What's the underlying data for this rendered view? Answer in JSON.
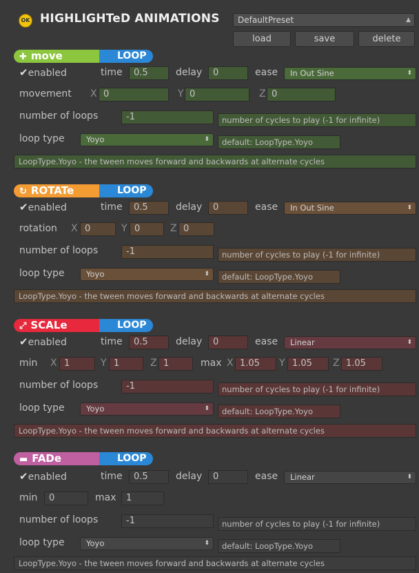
{
  "header": {
    "icon_text": "OK",
    "title": "HIGHLIGHTeD ANIMATIONS",
    "preset": "DefaultPreset",
    "buttons": {
      "load": "load",
      "save": "save",
      "delete": "delete"
    }
  },
  "labels": {
    "enabled": "enabled",
    "time": "time",
    "delay": "delay",
    "ease": "ease",
    "number_of_loops": "number of loops",
    "loop_type": "loop type",
    "cycles_hint": "number of cycles to play (-1 for infinite)",
    "default_hint": "default: LoopType.Yoyo",
    "description": "LoopType.Yoyo - the tween moves forward and backwards at alternate cycles",
    "loop_badge": "LOOP",
    "x": "X",
    "y": "Y",
    "z": "Z",
    "min": "min",
    "max": "max"
  },
  "sections": {
    "move": {
      "name": "move",
      "icon": "✚",
      "color": "#8cc63f",
      "time": "0.5",
      "delay": "0",
      "ease": "In Out Sine",
      "vector_label": "movement",
      "x": "0",
      "y": "0",
      "z": "0",
      "loops": "-1",
      "loop_type": "Yoyo"
    },
    "rotate": {
      "name": "ROTATe",
      "icon": "↻",
      "color": "#f39c34",
      "time": "0.5",
      "delay": "0",
      "ease": "In Out Sine",
      "vector_label": "rotation",
      "x": "0",
      "y": "0",
      "z": "0",
      "loops": "-1",
      "loop_type": "Yoyo"
    },
    "scale": {
      "name": "SCALe",
      "icon": "⤢",
      "color": "#e8283c",
      "time": "0.5",
      "delay": "0",
      "ease": "Linear",
      "min_x": "1",
      "min_y": "1",
      "min_z": "1",
      "max_x": "1.05",
      "max_y": "1.05",
      "max_z": "1.05",
      "loops": "-1",
      "loop_type": "Yoyo"
    },
    "fade": {
      "name": "FADe",
      "icon": "▬",
      "color": "#c060a0",
      "time": "0.5",
      "delay": "0",
      "ease": "Linear",
      "min": "0",
      "max": "1",
      "loops": "-1",
      "loop_type": "Yoyo"
    }
  },
  "colors": {
    "move_tint": "#435a36",
    "rotate_tint": "#5a4634",
    "scale_tint": "#5a3636",
    "fade_tint": "#3d3d3d",
    "loop_badge": "#2b88d6"
  }
}
